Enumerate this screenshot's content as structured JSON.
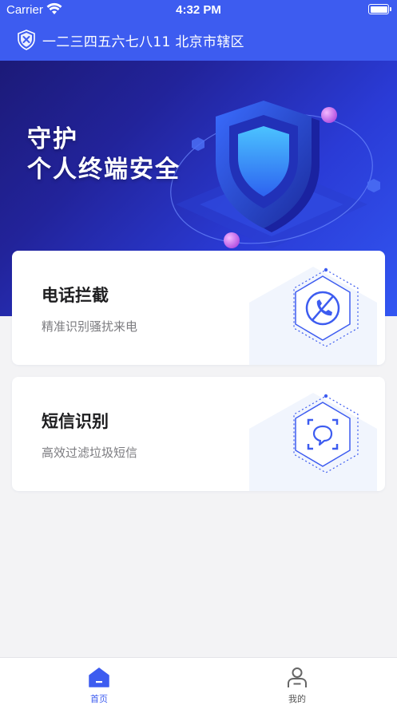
{
  "status_bar": {
    "carrier": "Carrier",
    "time": "4:32 PM"
  },
  "header": {
    "title": "一二三四五六七八11 北京市辖区",
    "logo_icon": "shield-badge-icon"
  },
  "banner": {
    "line1": "守护",
    "line2": "个人终端安全",
    "art_icon": "security-shield-illustration"
  },
  "cards": [
    {
      "title": "电话拦截",
      "subtitle": "精准识别骚扰来电",
      "icon": "blocked-phone-icon"
    },
    {
      "title": "短信识别",
      "subtitle": "高效过滤垃圾短信",
      "icon": "message-scan-icon"
    }
  ],
  "tabbar": {
    "items": [
      {
        "label": "首页",
        "icon": "home-icon",
        "active": true
      },
      {
        "label": "我的",
        "icon": "user-icon",
        "active": false
      }
    ]
  },
  "colors": {
    "primary": "#3d5cf0",
    "banner_dark": "#1c1a78",
    "text_main": "#1d1d1f",
    "text_sub": "#7c7c80"
  }
}
